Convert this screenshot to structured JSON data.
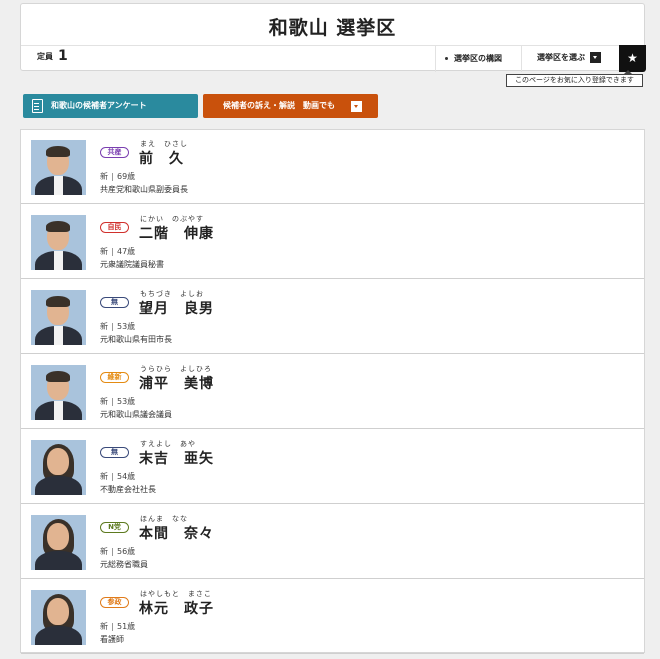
{
  "page": {
    "title": "和歌山 選挙区",
    "teiin_label": "定員",
    "teiin_value": "1",
    "kouzu_label": "選挙区の構図",
    "select_label": "選挙区を選ぶ",
    "star_glyph": "★",
    "fav_tooltip": "このページをお気に入り登録できます"
  },
  "buttons": {
    "enquete_label": "和歌山の候補者アンケート",
    "movie_label": "候補者の訴え・解説　動画でも"
  },
  "colors": {
    "teal": "#2a8a9e",
    "orange": "#c9510c"
  },
  "candidates": [
    {
      "party": "共産",
      "party_color": "#7a3fb0",
      "ruby": "まえ　ひさし",
      "name": "前　久",
      "status": "新",
      "age": "69歳",
      "career": "共産党和歌山県副委員長"
    },
    {
      "party": "自民",
      "party_color": "#d0302c",
      "ruby": "にかい　のぶやす",
      "name": "二階　伸康",
      "status": "新",
      "age": "47歳",
      "career": "元衆議院議員秘書"
    },
    {
      "party": "無",
      "party_color": "#3a4a7a",
      "ruby": "もちづき　よしお",
      "name": "望月　良男",
      "status": "新",
      "age": "53歳",
      "career": "元和歌山県有田市長"
    },
    {
      "party": "維新",
      "party_color": "#e48b12",
      "ruby": "うらひら　よしひろ",
      "name": "浦平　美博",
      "status": "新",
      "age": "53歳",
      "career": "元和歌山県議会議員"
    },
    {
      "party": "無",
      "party_color": "#3a4a7a",
      "ruby": "すえよし　あや",
      "name": "末吉　亜矢",
      "status": "新",
      "age": "54歳",
      "career": "不動産会社社長"
    },
    {
      "party": "N党",
      "party_color": "#5d7a1f",
      "ruby": "ほんま　なな",
      "name": "本間　奈々",
      "status": "新",
      "age": "56歳",
      "career": "元総務省職員"
    },
    {
      "party": "参政",
      "party_color": "#e07b1a",
      "ruby": "はやしもと　まさこ",
      "name": "林元　政子",
      "status": "新",
      "age": "51歳",
      "career": "看護師"
    }
  ]
}
